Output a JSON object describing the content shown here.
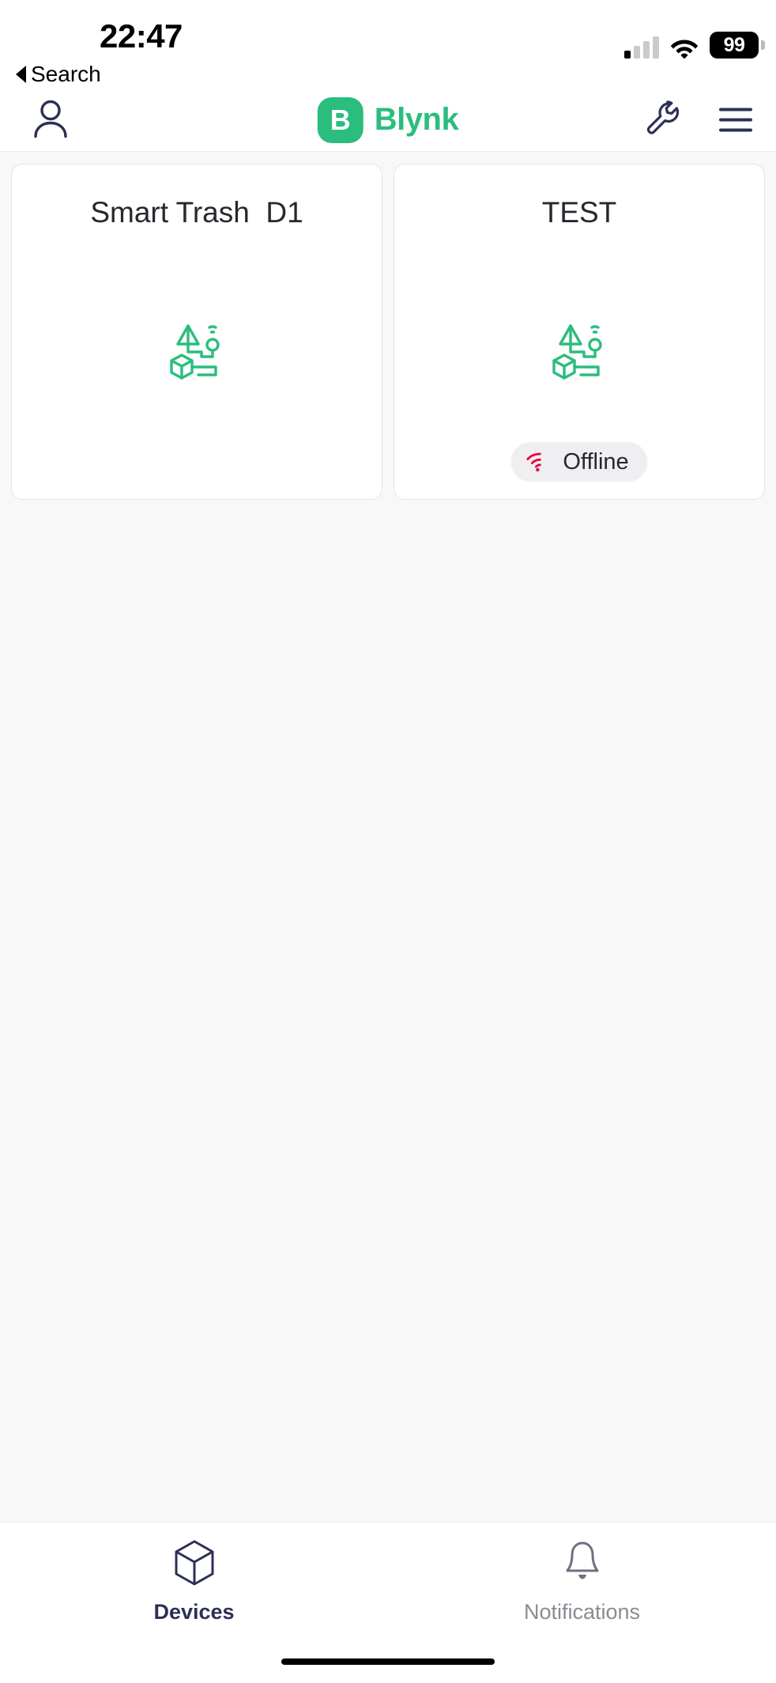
{
  "status_bar": {
    "time": "22:47",
    "back_label": "Search",
    "battery_level": "99",
    "signal_icon": "cellular-signal-icon",
    "wifi_icon": "wifi-icon",
    "battery_icon": "battery-icon"
  },
  "header": {
    "profile_icon": "profile-icon",
    "brand_letter": "B",
    "brand_name": "Blynk",
    "tools_icon": "wrench-icon",
    "menu_icon": "hamburger-menu-icon",
    "brand_color": "#2bbd7e",
    "icon_color": "#2c3056"
  },
  "devices": [
    {
      "name": "Smart Trash  D1",
      "icon": "iot-device-icon",
      "status": null
    },
    {
      "name": "TEST",
      "icon": "iot-device-icon",
      "status": "Offline",
      "status_icon": "wifi-offline-icon",
      "status_color": "#e8003d"
    }
  ],
  "bottom_nav": {
    "items": [
      {
        "label": "Devices",
        "icon": "cube-icon",
        "active": true
      },
      {
        "label": "Notifications",
        "icon": "bell-icon",
        "active": false
      }
    ],
    "active_color": "#2c3056",
    "inactive_color": "#8b8b93"
  }
}
